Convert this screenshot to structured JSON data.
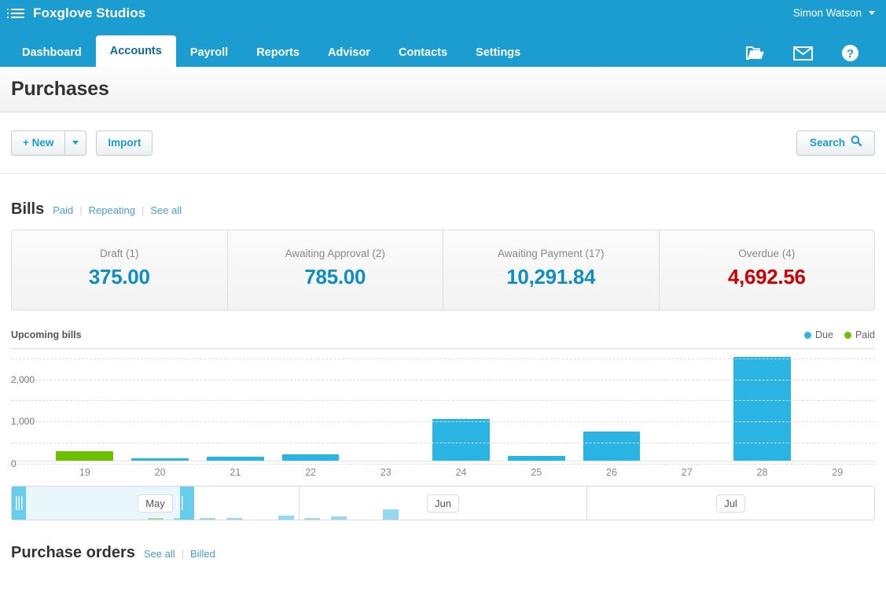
{
  "header": {
    "brand": "Foxglove Studios",
    "menu_icon": "list-menu-icon",
    "user": "Simon Watson",
    "icons": [
      {
        "name": "folder-icon",
        "label": "Files"
      },
      {
        "name": "envelope-icon",
        "label": "Messages"
      },
      {
        "name": "help-icon",
        "label": "Help"
      }
    ]
  },
  "nav": {
    "tabs": [
      {
        "label": "Dashboard",
        "active": false
      },
      {
        "label": "Accounts",
        "active": true
      },
      {
        "label": "Payroll",
        "active": false
      },
      {
        "label": "Reports",
        "active": false
      },
      {
        "label": "Advisor",
        "active": false
      },
      {
        "label": "Contacts",
        "active": false
      },
      {
        "label": "Settings",
        "active": false
      }
    ]
  },
  "page": {
    "title": "Purchases"
  },
  "toolbar": {
    "new_label": "+ New",
    "new_caret": "chevron-down-icon",
    "import_label": "Import",
    "search_label": "Search",
    "search_icon": "search-icon"
  },
  "bills": {
    "title": "Bills",
    "links": [
      "Paid",
      "Repeating",
      "See all"
    ],
    "cards": [
      {
        "label": "Draft (1)",
        "value": "375.00",
        "tone": "normal"
      },
      {
        "label": "Awaiting Approval (2)",
        "value": "785.00",
        "tone": "normal"
      },
      {
        "label": "Awaiting Payment (17)",
        "value": "10,291.84",
        "tone": "normal"
      },
      {
        "label": "Overdue (4)",
        "value": "4,692.56",
        "tone": "danger"
      }
    ]
  },
  "chart": {
    "title": "Upcoming bills",
    "legend": [
      {
        "label": "Due",
        "color": "#29b4e3"
      },
      {
        "label": "Paid",
        "color": "#6cc000"
      }
    ],
    "scrubber": {
      "months": [
        "May",
        "Jun",
        "Jul"
      ],
      "selected_month": "May",
      "handle_icon": "drag-handle-icon"
    }
  },
  "chart_data": {
    "type": "bar",
    "title": "Upcoming bills",
    "xlabel": "",
    "ylabel": "",
    "ylim": [
      0,
      2700
    ],
    "yticks": [
      0,
      1000,
      2000
    ],
    "ytick_labels": [
      "0",
      "1,000",
      "2,000"
    ],
    "gridlines": [
      0,
      500,
      1000,
      1500,
      2000,
      2500
    ],
    "grid": true,
    "legend_position": "top-right",
    "categories": [
      "19",
      "20",
      "21",
      "22",
      "23",
      "24",
      "25",
      "26",
      "27",
      "28",
      "29"
    ],
    "series": [
      {
        "name": "Due",
        "color": "#29b4e3",
        "values": [
          0,
          75,
          110,
          175,
          0,
          1000,
          130,
          700,
          0,
          2480,
          0
        ]
      },
      {
        "name": "Paid",
        "color": "#6cc000",
        "values": [
          240,
          0,
          0,
          0,
          0,
          0,
          0,
          0,
          0,
          0,
          0
        ]
      }
    ]
  },
  "purchase_orders": {
    "title": "Purchase orders",
    "links": [
      "See all",
      "Billed"
    ]
  }
}
